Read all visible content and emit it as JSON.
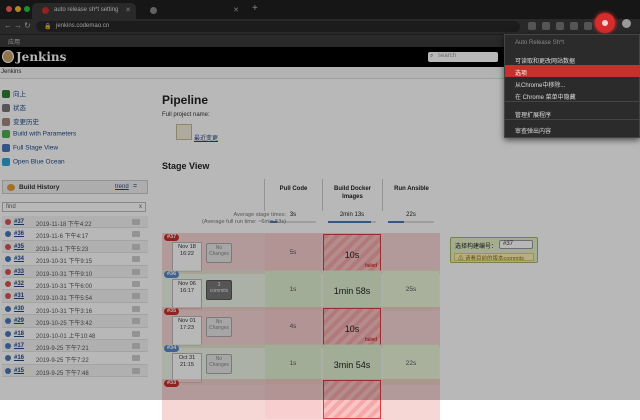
{
  "browser": {
    "tabs": [
      {
        "title": "auto release sh*t setting",
        "active": true
      },
      {
        "title": "",
        "active": false
      }
    ],
    "url": "jenkins.codemao.cn",
    "bookmark": "应用"
  },
  "jenkins": {
    "title": "Jenkins",
    "search_placeholder": "search",
    "breadcrumb": "Jenkins"
  },
  "sidebar": {
    "items": [
      {
        "label": "向上",
        "icon": "up-arrow-icon",
        "color": "#2e7d32"
      },
      {
        "label": "状态",
        "icon": "search-icon",
        "color": "#777777"
      },
      {
        "label": "变更历史",
        "icon": "notepad-icon",
        "color": "#a1887f"
      },
      {
        "label": "Build with Parameters",
        "icon": "clock-icon",
        "color": "#4caf50"
      },
      {
        "label": "Full Stage View",
        "icon": "stage-view-icon",
        "color": "#4a78b8"
      },
      {
        "label": "Open Blue Ocean",
        "icon": "blue-ocean-icon",
        "color": "#29a6d6"
      }
    ],
    "build_history": {
      "title": "Build History",
      "trend": "trend",
      "filter": "find",
      "clear": "x"
    },
    "builds": [
      {
        "num": "#37",
        "date": "2019-11-18 下午4:22",
        "status": "#d9534f"
      },
      {
        "num": "#36",
        "date": "2019-11-6 下午4:17",
        "status": "#4a78b8"
      },
      {
        "num": "#35",
        "date": "2019-11-1 下午5:23",
        "status": "#d9534f"
      },
      {
        "num": "#34",
        "date": "2019-10-31 下午9:15",
        "status": "#4a78b8"
      },
      {
        "num": "#33",
        "date": "2019-10-31 下午9:10",
        "status": "#d9534f"
      },
      {
        "num": "#32",
        "date": "2019-10-31 下午6:00",
        "status": "#d9534f"
      },
      {
        "num": "#31",
        "date": "2019-10-31 下午5:54",
        "status": "#d9534f"
      },
      {
        "num": "#30",
        "date": "2019-10-31 下午3:16",
        "status": "#4a78b8"
      },
      {
        "num": "#29",
        "date": "2019-10-25 下午3:42",
        "status": "#4a78b8"
      },
      {
        "num": "#18",
        "date": "2019-10-01 上午10:48",
        "status": "#4a78b8"
      },
      {
        "num": "#17",
        "date": "2019-9-25 下午7:21",
        "status": "#4a78b8"
      },
      {
        "num": "#16",
        "date": "2019-9-25 下午7:22",
        "status": "#4a78b8"
      },
      {
        "num": "#15",
        "date": "2019-9-25 下午7:48",
        "status": "#4a78b8"
      }
    ]
  },
  "main": {
    "title": "Pipeline",
    "project_name": "Full project name:",
    "edit_link": "最近变更",
    "stage_view": "Stage View",
    "avg_label": "Average stage times:\n(Average full run time: ~6min 53s)",
    "columns": [
      {
        "name": "Pull Code",
        "avg": "3s",
        "progress": 0.15
      },
      {
        "name": "Build Docker Images",
        "avg": "2min 13s",
        "progress": 0.9
      },
      {
        "name": "Run Ansible",
        "avg": "22s",
        "progress": 0.35
      }
    ],
    "rows": [
      {
        "badge": "#37",
        "badge_color": "#c9302c",
        "date": "Nov 18",
        "time": "16:22",
        "changes": "No\nChanges",
        "changes_dark": false,
        "cells": [
          "5s",
          "10s",
          ""
        ],
        "failed": true
      },
      {
        "badge": "#36",
        "badge_color": "#5b87c6",
        "date": "Nov 06",
        "time": "16:17",
        "changes": "3\ncommits",
        "changes_dark": true,
        "cells": [
          "1s",
          "1min 58s",
          "25s"
        ],
        "failed": false
      },
      {
        "badge": "#35",
        "badge_color": "#c9302c",
        "date": "Nov 01",
        "time": "17:23",
        "changes": "No\nChanges",
        "changes_dark": false,
        "cells": [
          "4s",
          "10s",
          ""
        ],
        "failed": true
      },
      {
        "badge": "#34",
        "badge_color": "#5b87c6",
        "date": "Oct 31",
        "time": "21:15",
        "changes": "No\nChanges",
        "changes_dark": false,
        "cells": [
          "1s",
          "3min 54s",
          "22s"
        ],
        "failed": false
      },
      {
        "badge": "#33",
        "badge_color": "#c9302c",
        "date": "",
        "time": "",
        "changes": "",
        "changes_dark": false,
        "cells": [
          "",
          "",
          ""
        ],
        "failed": true
      }
    ],
    "failed_label": "failed",
    "select_box": {
      "label": "选择构建编号：",
      "value": "#37",
      "warning": "⚠ 请看目前的版本commits"
    }
  },
  "ext_menu": {
    "header": "Auto Release Sh*t",
    "items": [
      "可读取和更改网站数据",
      "选项",
      "从Chrome中移除...",
      "在 Chrome 菜单中隐藏",
      "管理扩展程序",
      "审查弹出内容"
    ],
    "highlighted": 1
  }
}
